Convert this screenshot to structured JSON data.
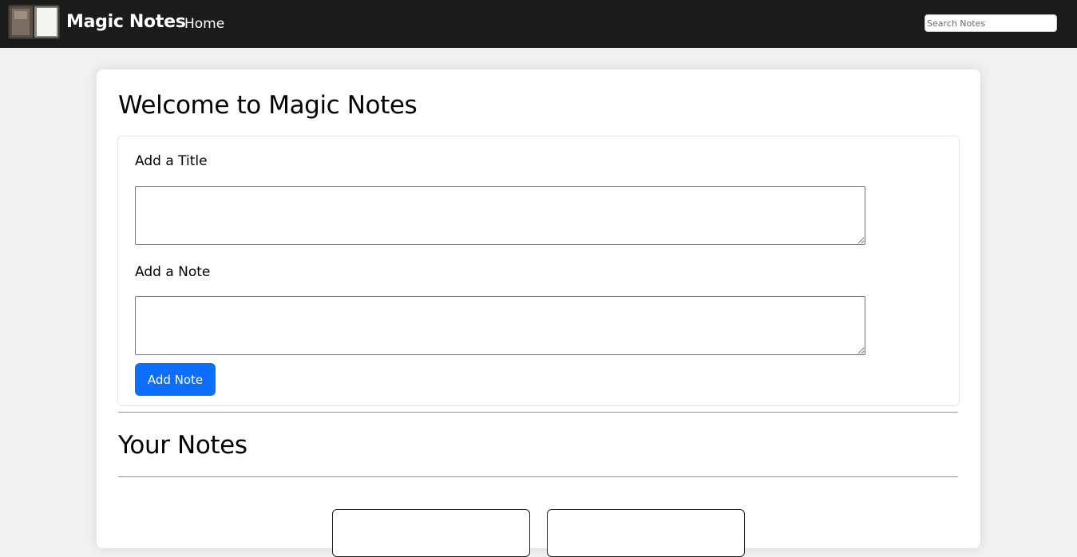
{
  "navbar": {
    "brand": "Magic Notes",
    "home_label": "Home",
    "search_placeholder": "Search Notes",
    "logo_icon": "notebook-logo-icon"
  },
  "main": {
    "title": "Welcome to Magic Notes",
    "form": {
      "title_label": "Add a Title",
      "title_value": "",
      "note_label": "Add a Note",
      "note_value": "",
      "add_button_label": "Add Note"
    },
    "notes_heading": "Your Notes"
  },
  "colors": {
    "navbar_bg": "#1b1b1b",
    "accent": "#0d6efd",
    "page_bg": "#f1f1f1"
  }
}
